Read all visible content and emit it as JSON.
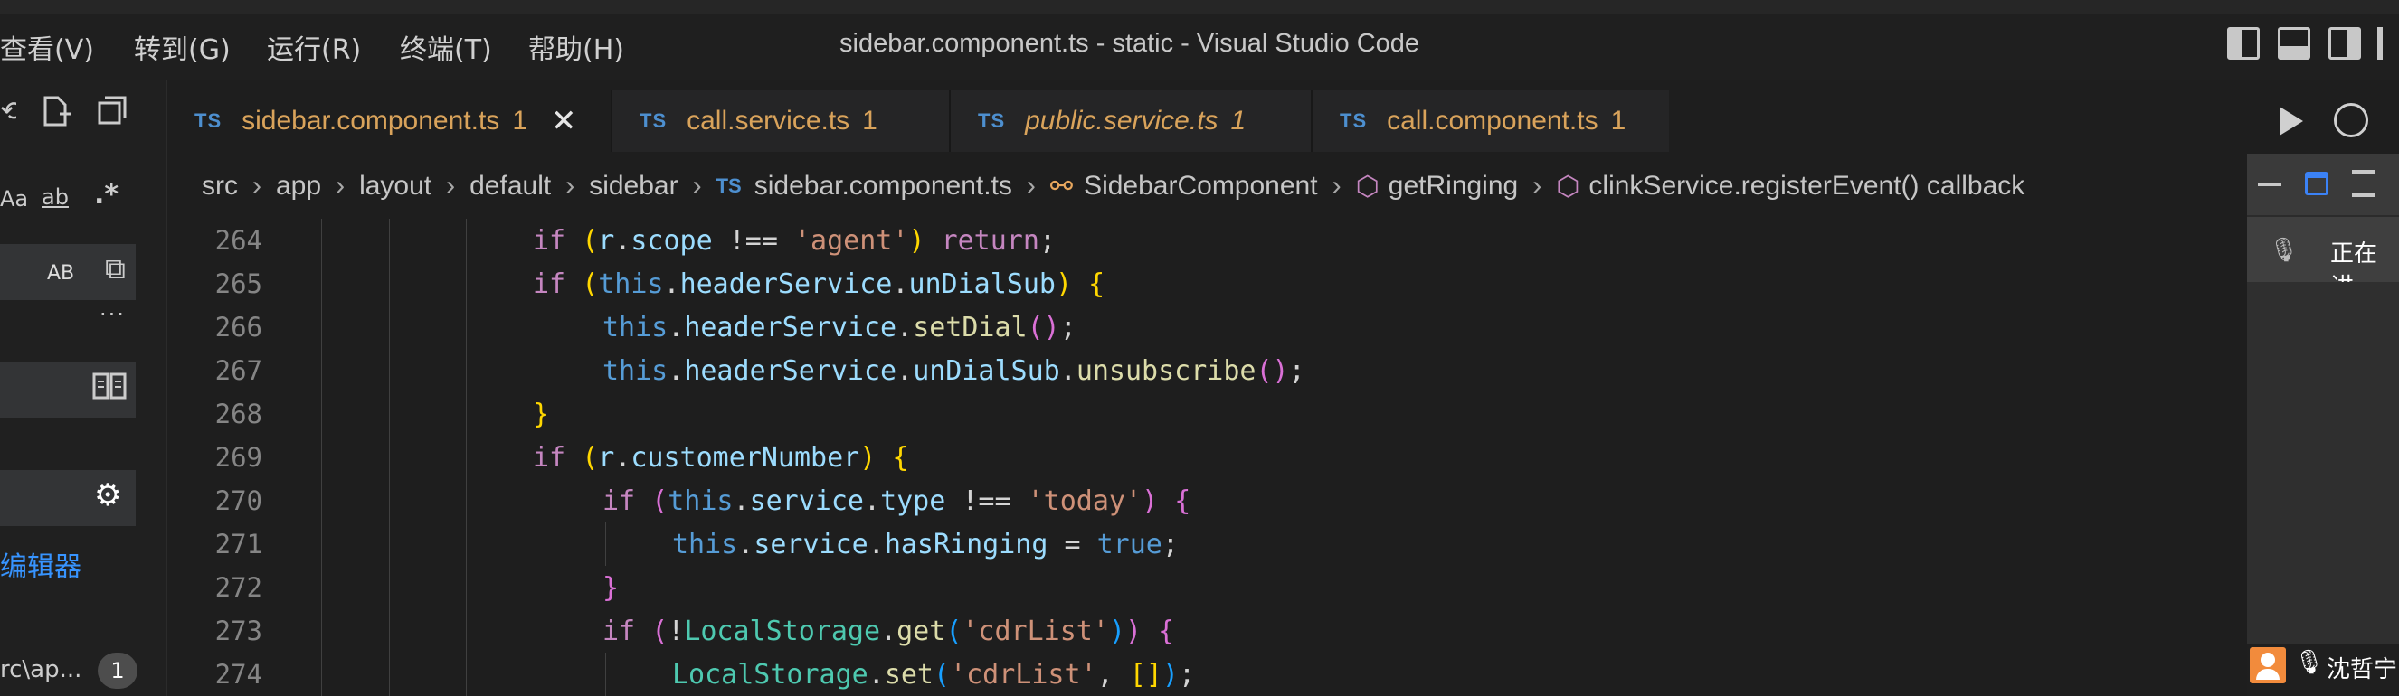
{
  "menubar": {
    "items": [
      "查看(V)",
      "转到(G)",
      "运行(R)",
      "终端(T)",
      "帮助(H)"
    ]
  },
  "window": {
    "title": "sidebar.component.ts - static - Visual Studio Code"
  },
  "leftpane": {
    "case_label": "Aa",
    "word_label": "ab",
    "regex_label": ".*",
    "preserve_case_label": "AB",
    "more_label": "···",
    "edit_link": "编辑器",
    "path_text": "rc\\ap...",
    "badge_count": "1"
  },
  "tabs": [
    {
      "lang": "TS",
      "name": "sidebar.component.ts",
      "count": "1",
      "active": true,
      "close": "✕"
    },
    {
      "lang": "TS",
      "name": "call.service.ts",
      "count": "1",
      "active": false
    },
    {
      "lang": "TS",
      "name": "public.service.ts",
      "count": "1",
      "active": false
    },
    {
      "lang": "TS",
      "name": "call.component.ts",
      "count": "1",
      "active": false
    }
  ],
  "breadcrumb": {
    "parts": [
      "src",
      "app",
      "layout",
      "default",
      "sidebar"
    ],
    "file_lang": "TS",
    "file": "sidebar.component.ts",
    "class": "SidebarComponent",
    "method": "getRinging",
    "callback": "clinkService.registerEvent() callback"
  },
  "editor": {
    "line_numbers": [
      "264",
      "265",
      "266",
      "267",
      "268",
      "269",
      "270",
      "271",
      "272",
      "273",
      "274"
    ]
  },
  "meeting": {
    "talking_label": "正在讲",
    "user_name": "沈哲宁"
  },
  "colors": {
    "accent_blue": "#4d8fcf",
    "warning_orange": "#d9a35b",
    "avatar_orange": "#f28b3c"
  }
}
